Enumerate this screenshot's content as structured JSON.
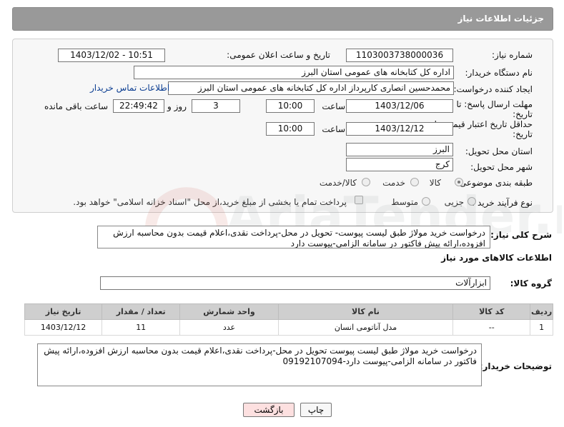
{
  "header": {
    "title": "جزئیات اطلاعات نیاز"
  },
  "form": {
    "need_number_label": "شماره نیاز:",
    "need_number": "1103003738000036",
    "announce_label": "تاریخ و ساعت اعلان عمومی:",
    "announce_value": "1403/12/02 - 10:51",
    "buyer_org_label": "نام دستگاه خریدار:",
    "buyer_org": "اداره کل کتابخانه های عمومی استان البرز",
    "creator_label": "ایجاد کننده درخواست:",
    "creator": "محمدحسین انصاری کارپرداز اداره کل کتابخانه های عمومی استان البرز",
    "contact_link": "اطلاعات تماس خریدار",
    "deadline_label_1": "مهلت ارسال پاسخ: تا",
    "deadline_label_2": "تاریخ:",
    "deadline_date": "1403/12/06",
    "time_label": "ساعت",
    "deadline_time": "10:00",
    "days_value": "3",
    "days_label": "روز و",
    "remaining_time": "22:49:42",
    "remaining_label": "ساعت باقی مانده",
    "validity_label_1": "حداقل تاریخ اعتبار قیمت: تا",
    "validity_label_2": "تاریخ:",
    "validity_date": "1403/12/12",
    "validity_time": "10:00",
    "province_label": "استان محل تحویل:",
    "province": "البرز",
    "city_label": "شهر محل تحویل:",
    "city": "کرج",
    "category_label": "طبقه بندی موضوعی:",
    "category_options": [
      "کالا",
      "خدمت",
      "کالا/خدمت"
    ],
    "process_label": "نوع فرآیند خرید :",
    "process_options": [
      "جزیی",
      "متوسط"
    ],
    "process_note": "پرداخت تمام یا بخشی از مبلغ خرید،از محل \"اسناد خزانه اسلامی\" خواهد بود."
  },
  "general_desc": {
    "label": "شرح کلی نیاز:",
    "text": "درخواست خرید مولاژ طبق لیست پیوست- تحویل در محل-پرداخت نقدی،اعلام قیمت بدون محاسبه ارزش افزوده،ارائه پیش فاکتور در سامانه الزامی-پیوست دارد"
  },
  "goods_section": {
    "title": "اطلاعات کالاهای مورد نیاز",
    "group_label": "گروه کالا:",
    "group_value": "ابزارآلات"
  },
  "table": {
    "headers": [
      "ردیف",
      "کد کالا",
      "نام کالا",
      "واحد شمارش",
      "تعداد / مقدار",
      "تاریخ نیاز"
    ],
    "rows": [
      [
        "1",
        "--",
        "مدل آناتومی انسان",
        "عدد",
        "11",
        "1403/12/12"
      ]
    ]
  },
  "buyer_desc": {
    "label": "توضیحات خریدار:",
    "text": "درخواست خرید مولاژ طبق لیست پیوست تحویل در محل-پرداخت نقدی،اعلام قیمت بدون محاسبه ارزش افزوده،ارائه پیش فاکتور در سامانه الزامی-پیوست دارد-09192107094"
  },
  "buttons": {
    "print": "چاپ",
    "back": "بازگشت"
  },
  "watermark": {
    "text": "AriaTender.neT"
  },
  "colors": {
    "header_bg": "#999999",
    "panel_bg": "#f7f7f7",
    "table_header_bg": "#cfcfcf",
    "link": "#0b3d91",
    "back_button_bg": "#fde0e0",
    "watermark": "#c0392b"
  }
}
